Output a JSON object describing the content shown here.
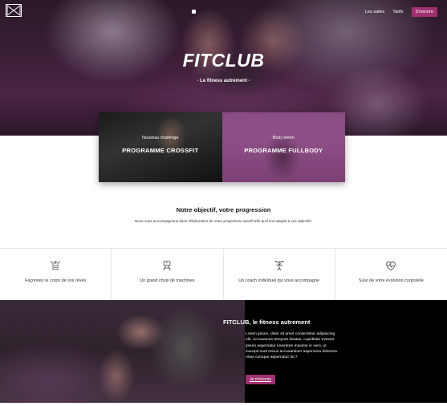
{
  "nav": {
    "logo_icon": "bowtie-logo-icon",
    "links": [
      "Les salles",
      "Tarifs"
    ],
    "signup_label": "S'inscrire"
  },
  "hero": {
    "title": "FITCLUB",
    "subtitle": "- Le fitness autrement -"
  },
  "programs": [
    {
      "tag": "Nouveau challenge",
      "title": "PROGRAMME CROSSFIT"
    },
    {
      "tag": "Body béton",
      "title": "PROGRAMME FULLBODY"
    }
  ],
  "objective": {
    "title": "Notre objectif, votre progression",
    "text": "Nous vous accompagnons dans l'élaboration de votre programme sportif afin qu'il soit adapté à vos objectifs."
  },
  "features": [
    {
      "icon": "body-shape-icon",
      "label": "Façonnez le corps de vos rêves"
    },
    {
      "icon": "machine-icon",
      "label": "Un grand choix de machines"
    },
    {
      "icon": "coach-icon",
      "label": "Un coach individuel qui vous accompagne"
    },
    {
      "icon": "heartbeat-icon",
      "label": "Suivi de votre évolution corporelle"
    }
  ],
  "about": {
    "title": "FITCLUB, le fitness autrement",
    "text": "Lorem ipsum, dolor sit amet consectetur adipisicing elit. Accusamus tempore beatae, cupiditate eveniet ipsum aspernatur inventore maxime in vero, ut suscipit sunt minus accusantium asperiores delectus. Alias cumque aspernatur hic?",
    "button_label": "Je m'inscris"
  },
  "colors": {
    "accent": "#a0306f",
    "hero_tint": "#4a2444",
    "dark": "#000000"
  }
}
